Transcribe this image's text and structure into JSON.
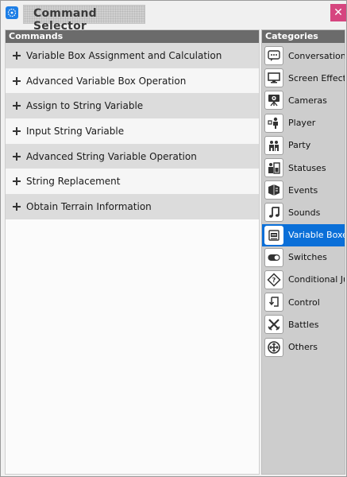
{
  "window": {
    "title": "Command Selector",
    "close_glyph": "✕"
  },
  "commands_panel": {
    "header": "Commands",
    "items": [
      {
        "label": "Variable Box Assignment and Calculation"
      },
      {
        "label": "Advanced Variable Box Operation"
      },
      {
        "label": "Assign to String Variable"
      },
      {
        "label": "Input String Variable"
      },
      {
        "label": "Advanced String Variable Operation"
      },
      {
        "label": "String Replacement"
      },
      {
        "label": "Obtain Terrain Information"
      }
    ]
  },
  "categories_panel": {
    "header": "Categories",
    "items": [
      {
        "label": "Conversation",
        "icon": "speech-bubble-icon"
      },
      {
        "label": "Screen Effects",
        "icon": "monitor-icon"
      },
      {
        "label": "Cameras",
        "icon": "camera-icon"
      },
      {
        "label": "Player",
        "icon": "player-icon"
      },
      {
        "label": "Party",
        "icon": "party-icon"
      },
      {
        "label": "Statuses",
        "icon": "status-icon"
      },
      {
        "label": "Events",
        "icon": "events-icon"
      },
      {
        "label": "Sounds",
        "icon": "music-note-icon"
      },
      {
        "label": "Variable Boxe",
        "icon": "variable-box-icon",
        "selected": true
      },
      {
        "label": "Switches",
        "icon": "toggle-icon"
      },
      {
        "label": "Conditional Ju",
        "icon": "conditional-icon"
      },
      {
        "label": "Control",
        "icon": "control-icon"
      },
      {
        "label": "Battles",
        "icon": "battle-icon"
      },
      {
        "label": "Others",
        "icon": "others-icon"
      }
    ]
  },
  "colors": {
    "accent": "#0a6fd8",
    "close": "#d6457f",
    "header": "#6b6b6b"
  }
}
